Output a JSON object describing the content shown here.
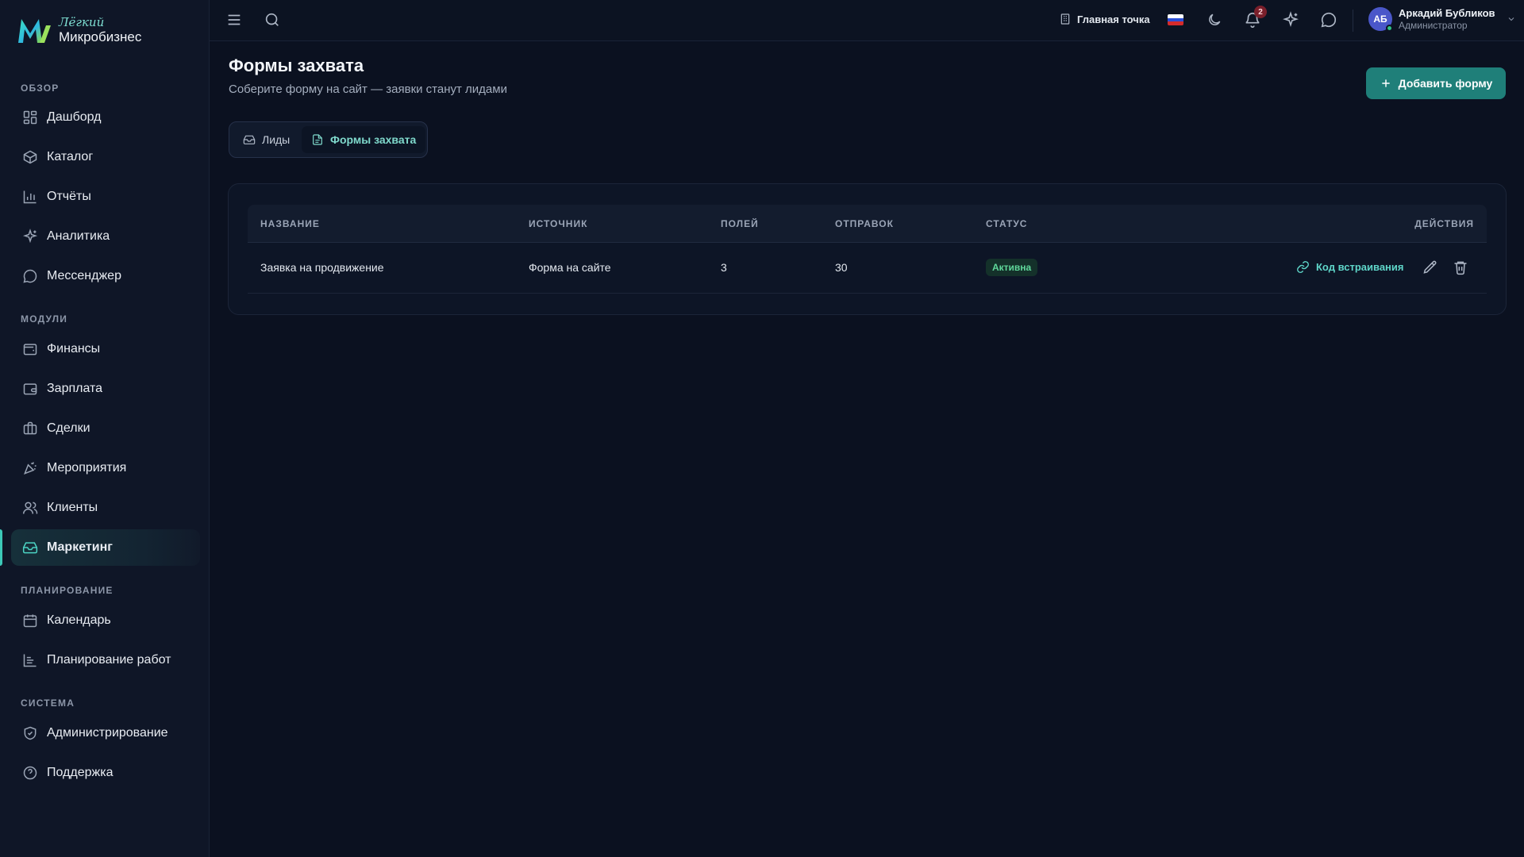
{
  "brand": {
    "top": "Лёгкий",
    "bottom": "Микробизнес"
  },
  "sidebar": {
    "sections": [
      {
        "title": "ОБЗОР",
        "items": [
          {
            "label": "Дашборд",
            "icon": "dashboard-icon"
          },
          {
            "label": "Каталог",
            "icon": "box-icon"
          },
          {
            "label": "Отчёты",
            "icon": "bar-chart-icon"
          },
          {
            "label": "Аналитика",
            "icon": "sparkles-icon"
          },
          {
            "label": "Мессенджер",
            "icon": "message-circle-icon"
          }
        ]
      },
      {
        "title": "МОДУЛИ",
        "items": [
          {
            "label": "Финансы",
            "icon": "wallet-icon"
          },
          {
            "label": "Зарплата",
            "icon": "wallet-icon"
          },
          {
            "label": "Сделки",
            "icon": "briefcase-icon"
          },
          {
            "label": "Мероприятия",
            "icon": "party-popper-icon"
          },
          {
            "label": "Клиенты",
            "icon": "users-icon"
          },
          {
            "label": "Маркетинг",
            "icon": "inbox-icon",
            "active": true
          }
        ]
      },
      {
        "title": "ПЛАНИРОВАНИЕ",
        "items": [
          {
            "label": "Календарь",
            "icon": "calendar-icon"
          },
          {
            "label": "Планирование работ",
            "icon": "gantt-icon"
          }
        ]
      },
      {
        "title": "СИСТЕМА",
        "items": [
          {
            "label": "Администрирование",
            "icon": "shield-icon"
          },
          {
            "label": "Поддержка",
            "icon": "help-circle-icon"
          }
        ]
      }
    ]
  },
  "topbar": {
    "location": "Главная точка",
    "notifications_count": "2",
    "user": {
      "initials": "АБ",
      "name": "Аркадий Бубликов",
      "role": "Администратор"
    }
  },
  "page": {
    "title": "Формы захвата",
    "subtitle": "Соберите форму на сайт — заявки станут лидами",
    "add_button": "Добавить форму",
    "tabs": [
      {
        "label": "Лиды",
        "icon": "inbox-icon"
      },
      {
        "label": "Формы захвата",
        "icon": "file-text-icon",
        "active": true
      }
    ]
  },
  "table": {
    "columns": [
      "НАЗВАНИЕ",
      "ИСТОЧНИК",
      "ПОЛЕЙ",
      "ОТПРАВОК",
      "СТАТУС",
      "ДЕЙСТВИЯ"
    ],
    "rows": [
      {
        "name": "Заявка на продвижение",
        "source": "Форма на сайте",
        "fields": "3",
        "submissions": "30",
        "status": "Активна",
        "embed_label": "Код встраивания"
      }
    ]
  },
  "colors": {
    "accent": "#1f7f79",
    "accent_text": "#5fd6c9",
    "status_active": "#5fd79a",
    "background": "#0b1120"
  }
}
